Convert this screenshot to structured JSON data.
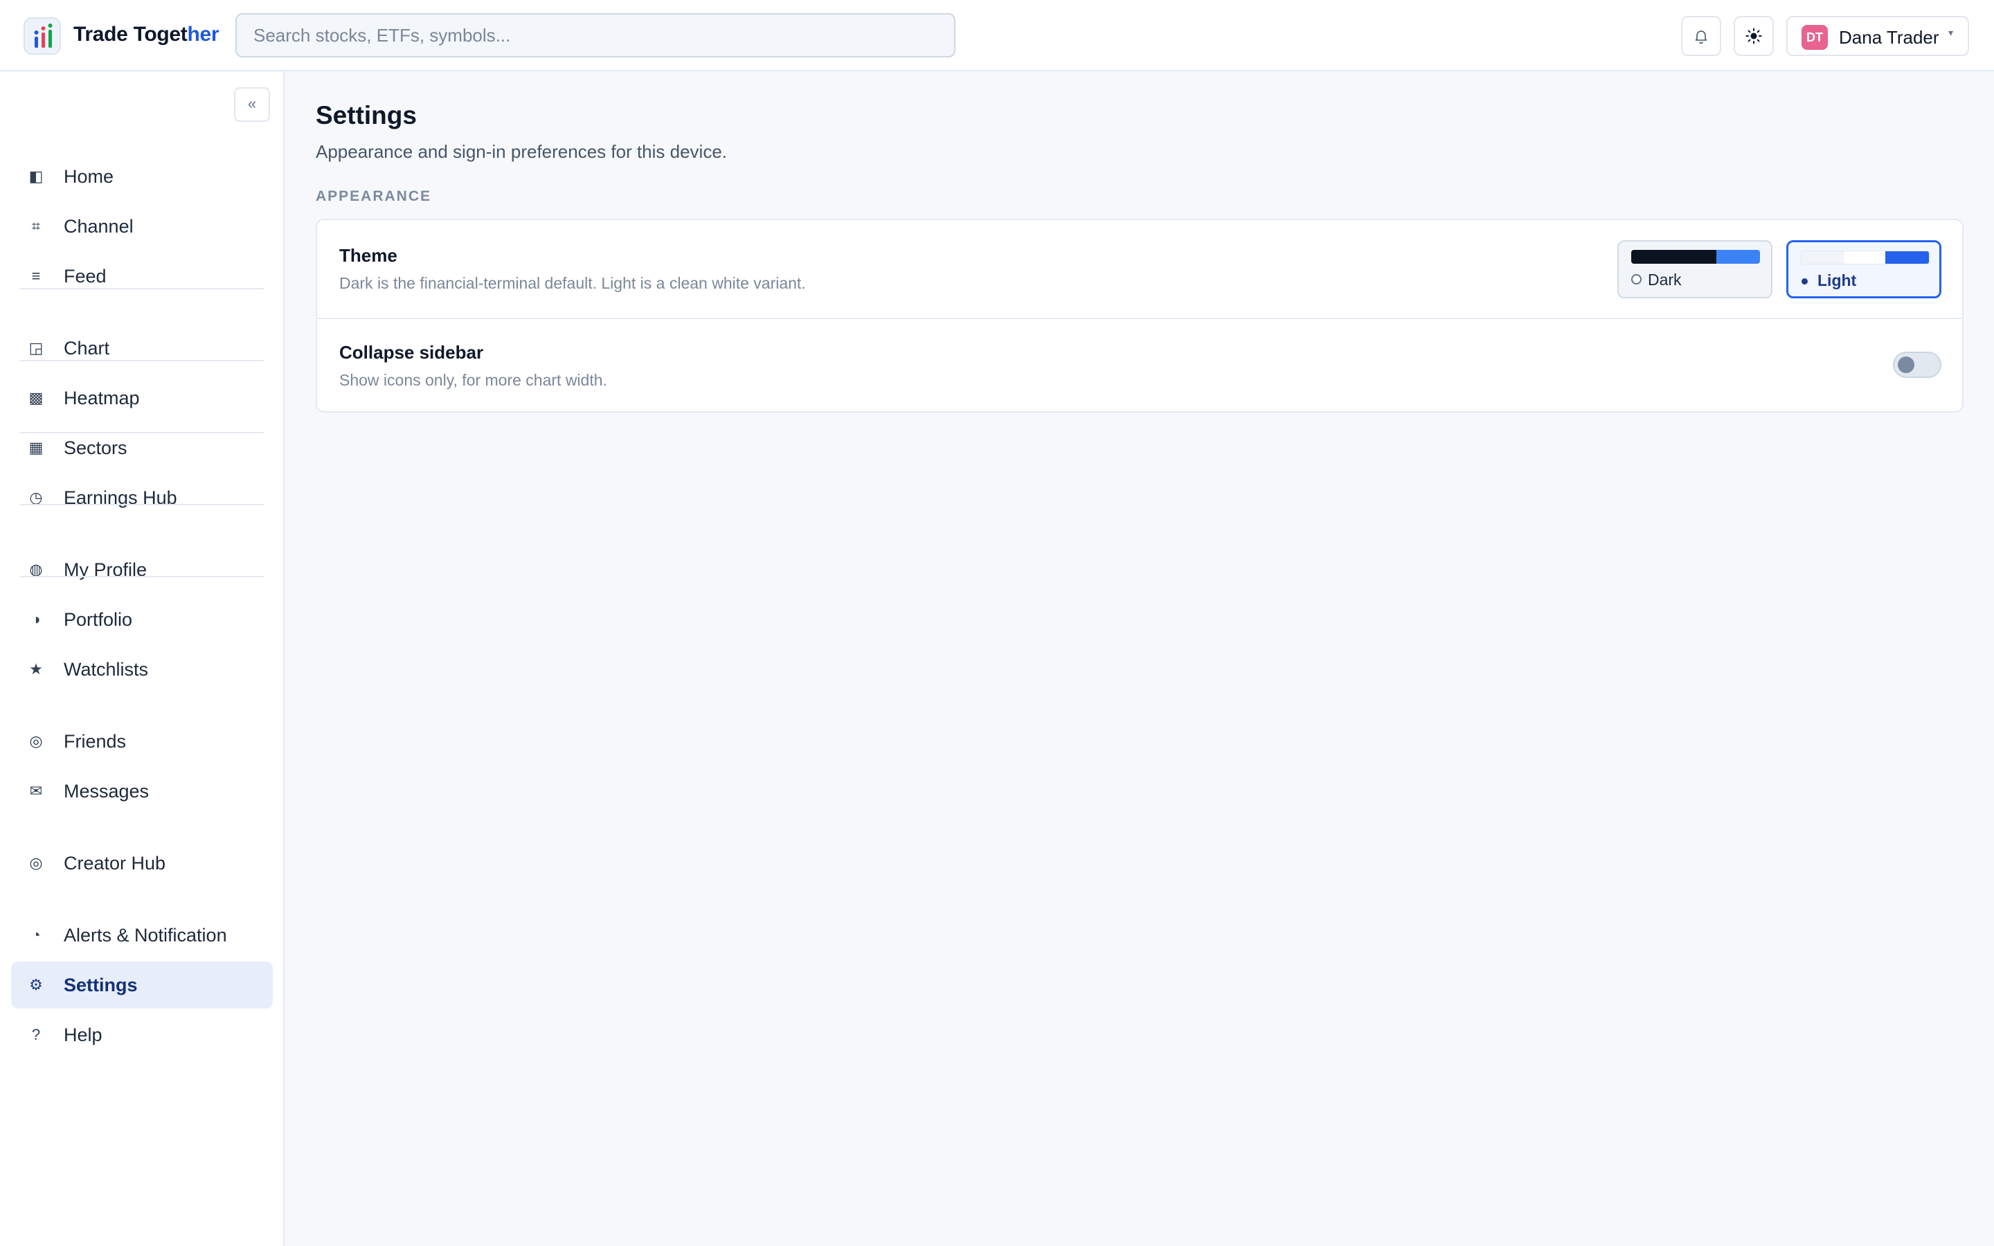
{
  "header": {
    "brand_primary": "Trade Toget",
    "brand_accent": "her",
    "search_placeholder": "Search stocks, ETFs, symbols...",
    "notifications_icon": "bell-icon",
    "theme_toggle_icon": "sun-icon",
    "user": {
      "initials": "DT",
      "name": "Dana Trader",
      "caret": "▾",
      "avatar_color": "#e8638f"
    }
  },
  "sidebar": {
    "collapse_label": "«",
    "items": [
      {
        "label": "Home",
        "icon": "◧",
        "icon_name": "home-icon"
      },
      {
        "label": "Channel",
        "icon": "⌗",
        "icon_name": "channel-icon"
      },
      {
        "label": "Feed",
        "icon": "≡",
        "icon_name": "feed-icon"
      },
      {
        "label": "Chart",
        "icon": "◲",
        "icon_name": "chart-icon"
      },
      {
        "label": "Heatmap",
        "icon": "▩",
        "icon_name": "heatmap-icon"
      },
      {
        "label": "Sectors",
        "icon": "▦",
        "icon_name": "sectors-icon"
      },
      {
        "label": "Earnings Hub",
        "icon": "◷",
        "icon_name": "earnings-icon"
      },
      {
        "label": "My Profile",
        "icon": "◍",
        "icon_name": "profile-icon"
      },
      {
        "label": "Portfolio",
        "icon": "◑",
        "icon_name": "portfolio-icon"
      },
      {
        "label": "Watchlists",
        "icon": "★",
        "icon_name": "star-icon"
      },
      {
        "label": "Friends",
        "icon": "◎",
        "icon_name": "friends-icon"
      },
      {
        "label": "Messages",
        "icon": "✉",
        "icon_name": "mail-icon"
      },
      {
        "label": "Creator Hub",
        "icon": "◎",
        "icon_name": "creator-icon"
      },
      {
        "label": "Alerts & Notification",
        "icon": "◔",
        "icon_name": "alerts-icon"
      },
      {
        "label": "Settings",
        "icon": "⚙",
        "icon_name": "gear-icon",
        "active": true
      },
      {
        "label": "Help",
        "icon": "?",
        "icon_name": "help-icon"
      }
    ]
  },
  "main": {
    "title": "Settings",
    "subtitle": "Appearance and sign-in preferences for this device.",
    "section_label": "APPEARANCE",
    "theme": {
      "title": "Theme",
      "description": "Dark is the financial-terminal default. Light is a clean white variant.",
      "options": [
        {
          "label": "Dark",
          "selected": false
        },
        {
          "label": "Light",
          "selected": true
        }
      ]
    },
    "collapse_sidebar": {
      "title": "Collapse sidebar",
      "description": "Show icons only, for more chart width.",
      "enabled": false
    }
  },
  "colors": {
    "accent": "#2563eb",
    "brand_accent": "#1d5bd8",
    "active_nav_bg": "#e8eef9"
  }
}
